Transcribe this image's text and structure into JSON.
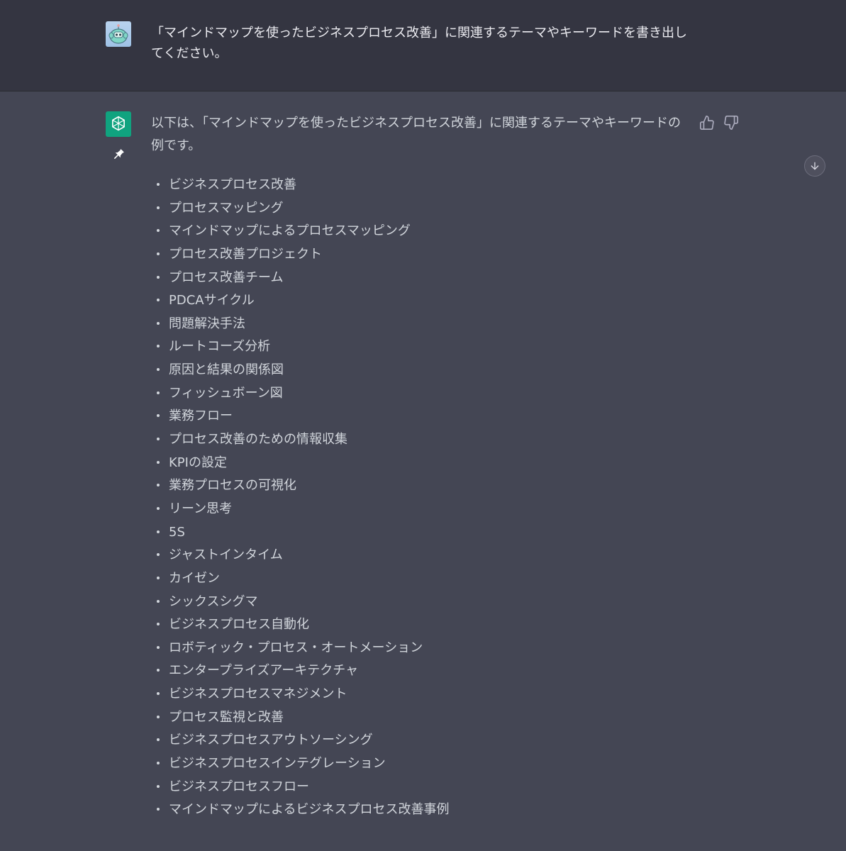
{
  "user_message": {
    "text": "「マインドマップを使ったビジネスプロセス改善」に関連するテーマやキーワードを書き出してください。"
  },
  "assistant_message": {
    "intro": "以下は、「マインドマップを使ったビジネスプロセス改善」に関連するテーマやキーワードの例です。",
    "items": [
      "ビジネスプロセス改善",
      "プロセスマッピング",
      "マインドマップによるプロセスマッピング",
      "プロセス改善プロジェクト",
      "プロセス改善チーム",
      "PDCAサイクル",
      "問題解決手法",
      "ルートコーズ分析",
      "原因と結果の関係図",
      "フィッシュボーン図",
      "業務フロー",
      "プロセス改善のための情報収集",
      "KPIの設定",
      "業務プロセスの可視化",
      "リーン思考",
      "5S",
      "ジャストインタイム",
      "カイゼン",
      "シックスシグマ",
      "ビジネスプロセス自動化",
      "ロボティック・プロセス・オートメーション",
      "エンタープライズアーキテクチャ",
      "ビジネスプロセスマネジメント",
      "プロセス監視と改善",
      "ビジネスプロセスアウトソーシング",
      "ビジネスプロセスインテグレーション",
      "ビジネスプロセスフロー",
      "マインドマップによるビジネスプロセス改善事例"
    ]
  },
  "icons": {
    "user_avatar": "robot-avatar-icon",
    "assistant_avatar": "openai-logo-icon",
    "pin": "pin-icon",
    "thumb_up": "thumbs-up-icon",
    "thumb_down": "thumbs-down-icon",
    "scroll": "arrow-down-icon"
  },
  "colors": {
    "user_bg": "#343541",
    "assistant_bg": "#444654",
    "brand": "#10a37f"
  }
}
